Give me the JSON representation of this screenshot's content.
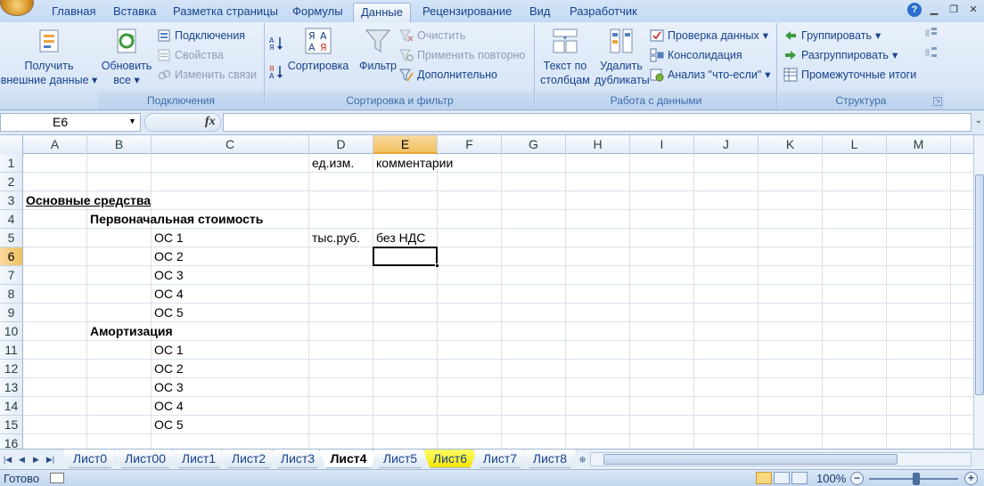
{
  "tabs": [
    "Главная",
    "Вставка",
    "Разметка страницы",
    "Формулы",
    "Данные",
    "Рецензирование",
    "Вид",
    "Разработчик"
  ],
  "active_tab": "Данные",
  "ribbon": {
    "get_external": {
      "line1": "Получить",
      "line2": "внешние данные"
    },
    "refresh_all": {
      "line1": "Обновить",
      "line2": "все"
    },
    "connections": "Подключения",
    "properties": "Свойства",
    "edit_links": "Изменить связи",
    "group_connections": "Подключения",
    "sort": "Сортировка",
    "filter": "Фильтр",
    "clear": "Очистить",
    "reapply": "Применить повторно",
    "advanced": "Дополнительно",
    "group_sort_filter": "Сортировка и фильтр",
    "text_to_columns": {
      "line1": "Текст по",
      "line2": "столбцам"
    },
    "remove_duplicates": {
      "line1": "Удалить",
      "line2": "дубликаты"
    },
    "data_validation": "Проверка данных",
    "consolidate": "Консолидация",
    "what_if": "Анализ \"что-если\"",
    "group_data_tools": "Работа с данными",
    "group": "Группировать",
    "ungroup": "Разгруппировать",
    "subtotal": "Промежуточные итоги",
    "group_outline": "Структура"
  },
  "formula_bar": {
    "name_box": "E6",
    "fx": "fx",
    "formula": ""
  },
  "columns": [
    "A",
    "B",
    "C",
    "D",
    "E",
    "F",
    "G",
    "H",
    "I",
    "J",
    "K",
    "L",
    "M"
  ],
  "selected_column": "E",
  "rows": [
    "1",
    "2",
    "3",
    "4",
    "5",
    "6",
    "7",
    "8",
    "9",
    "10",
    "11",
    "12",
    "13",
    "14",
    "15",
    "16"
  ],
  "selected_row": "6",
  "cells": {
    "D1": "ед.изм.",
    "E1": "комментарии",
    "A3": "Основные средства",
    "B4": "Первоначальная стоимость",
    "C5": "ОС 1",
    "D5": "тыс.руб.",
    "E5": "без НДС",
    "C6": "ОС 2",
    "C7": "ОС 3",
    "C8": "ОС 4",
    "C9": "ОС 5",
    "B10": "Амортизация",
    "C11": "ОС 1",
    "C12": "ОС 2",
    "C13": "ОС 3",
    "C14": "ОС 4",
    "C15": "ОС 5"
  },
  "sheets": [
    "Лист0",
    "Лист00",
    "Лист1",
    "Лист2",
    "Лист3",
    "Лист4",
    "Лист5",
    "Лист6",
    "Лист7",
    "Лист8"
  ],
  "active_sheet": "Лист4",
  "highlighted_sheet": "Лист6",
  "status": {
    "ready": "Готово",
    "zoom": "100%"
  }
}
